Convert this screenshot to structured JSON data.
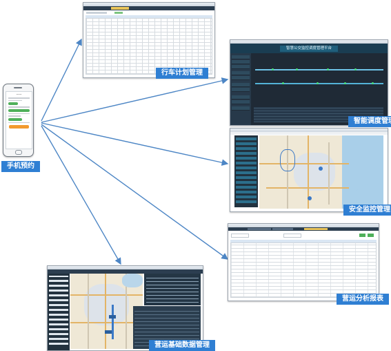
{
  "captions": {
    "phone": "手机预约",
    "plan": "行车计划管理",
    "dispatch": "智能调度管理",
    "monitor": "安全监控管理",
    "report": "营运分析报表",
    "basedata": "营运基础数据管理"
  },
  "dispatch_screen": {
    "header": "智慧公交监控调度管理平台"
  },
  "colors": {
    "caption_bg": "#2f7fd3",
    "arrow": "#4d86c5",
    "dark_bg": "#1f2a36",
    "accent_orange": "#f29a2e",
    "accent_green": "#4fb05a"
  }
}
